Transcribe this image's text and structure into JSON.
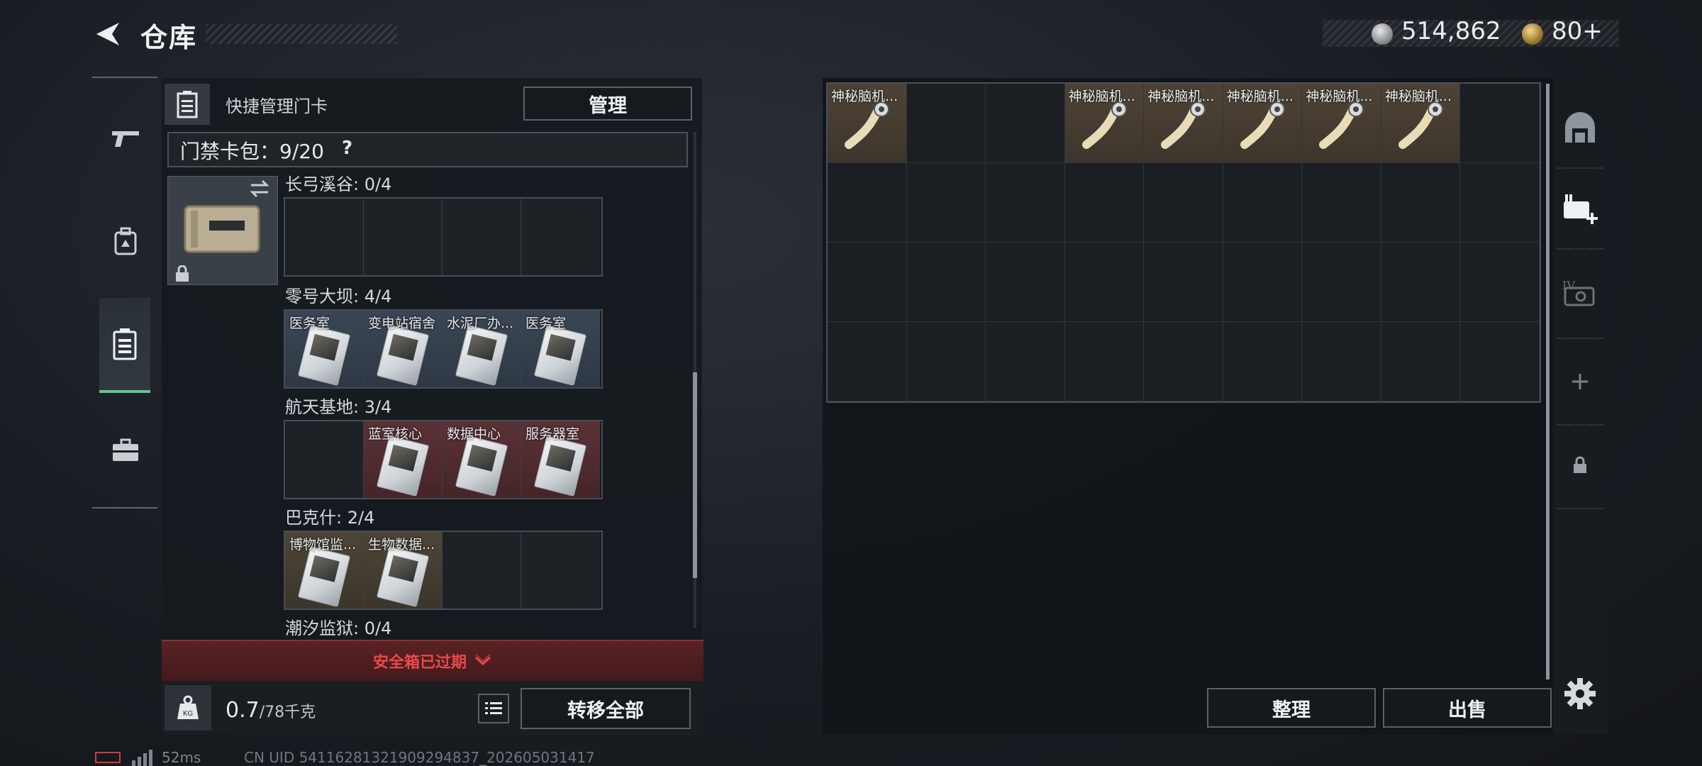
{
  "header": {
    "title": "仓库"
  },
  "currency": {
    "silver": "514,862",
    "gold": "80+"
  },
  "card_panel": {
    "quick_manage_label": "快捷管理门卡",
    "manage_button": "管理",
    "pack_label": "门禁卡包：9/20",
    "help": "?",
    "regions": [
      {
        "label": "长弓溪谷: 0/4",
        "slots": [
          {
            "name": "",
            "style": "empty"
          },
          {
            "name": "",
            "style": "empty"
          },
          {
            "name": "",
            "style": "empty"
          },
          {
            "name": "",
            "style": "empty"
          }
        ]
      },
      {
        "label": "零号大坝: 4/4",
        "slots": [
          {
            "name": "医务室",
            "style": "blue"
          },
          {
            "name": "变电站宿舍",
            "style": "blue"
          },
          {
            "name": "水泥厂办...",
            "style": "blue"
          },
          {
            "name": "医务室",
            "style": "blue"
          }
        ]
      },
      {
        "label": "航天基地: 3/4",
        "slots": [
          {
            "name": "",
            "style": "empty"
          },
          {
            "name": "蓝室核心",
            "style": "red"
          },
          {
            "name": "数据中心",
            "style": "red"
          },
          {
            "name": "服务器室",
            "style": "red"
          }
        ]
      },
      {
        "label": "巴克什: 2/4",
        "slots": [
          {
            "name": "博物馆监...",
            "style": "tan"
          },
          {
            "name": "生物数据...",
            "style": "tan"
          },
          {
            "name": "",
            "style": "empty"
          },
          {
            "name": "",
            "style": "empty"
          }
        ]
      },
      {
        "label": "潮汐监狱: 0/4",
        "slots": []
      }
    ],
    "warning": "安全箱已过期",
    "weight_current": "0.7",
    "weight_total": "/78千克",
    "transfer_all": "转移全部"
  },
  "storage": {
    "columns": 9,
    "rows": 4,
    "items": [
      {
        "index": 0,
        "name": "神秘脑机..."
      },
      {
        "index": 3,
        "name": "神秘脑机..."
      },
      {
        "index": 4,
        "name": "神秘脑机..."
      },
      {
        "index": 5,
        "name": "神秘脑机..."
      },
      {
        "index": 6,
        "name": "神秘脑机..."
      },
      {
        "index": 7,
        "name": "神秘脑机..."
      }
    ],
    "sort_button": "整理",
    "sell_button": "出售"
  },
  "status": {
    "ping": "52ms",
    "uid": "CN UID 5411628132190929483​7_202605031417"
  },
  "icons": {
    "back": "back-arrow-icon",
    "silver": "silver-coin-icon",
    "gold": "gold-coin-icon",
    "gun": "gun-icon",
    "backpack": "backpack-icon",
    "keycard": "keycard-icon",
    "case": "briefcase-icon",
    "settings": "gear-icon",
    "list": "list-icon",
    "weight": "weight-icon",
    "lock": "lock-icon",
    "swap": "swap-icon"
  },
  "colors": {
    "accent_green": "#63c78f",
    "warning_red": "#e84a4a"
  }
}
